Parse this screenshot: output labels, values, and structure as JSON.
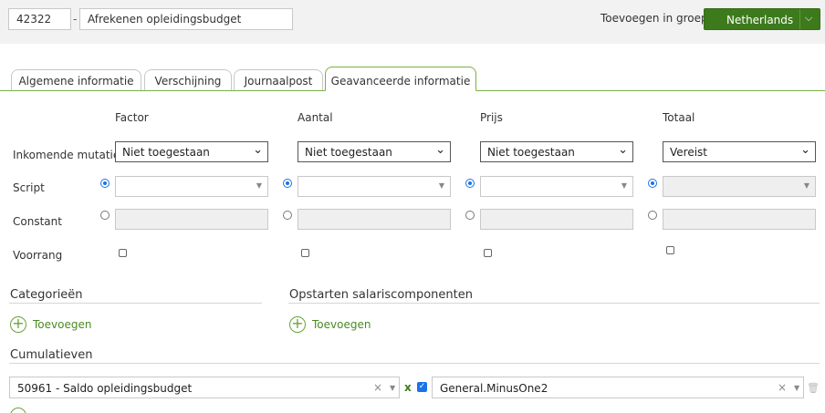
{
  "header": {
    "id_value": "42322",
    "separator": "-",
    "name_value": "Afrekenen opleidingsbudget",
    "group_label": "Toevoegen in groep",
    "group_button": "Netherlands",
    "group_chevron": "⌵"
  },
  "tabs": [
    {
      "label": "Algemene informatie",
      "active": false
    },
    {
      "label": "Verschijning",
      "active": false
    },
    {
      "label": "Journaalpost",
      "active": false
    },
    {
      "label": "Geavanceerde informatie",
      "active": true
    }
  ],
  "columns": [
    "Factor",
    "Aantal",
    "Prijs",
    "Totaal"
  ],
  "rows": {
    "incoming": "Inkomende mutatie",
    "script": "Script",
    "constant": "Constant",
    "priority": "Voorrang"
  },
  "incoming_values": [
    "Niet toegestaan",
    "Niet toegestaan",
    "Niet toegestaan",
    "Vereist"
  ],
  "select_arrow": "⌄",
  "combo_arrow": "▼",
  "sections": {
    "categories": "Categorieën",
    "startup": "Opstarten salariscomponenten",
    "cumulatives": "Cumulatieven",
    "add_label": "Toevoegen",
    "add_symbol": "+"
  },
  "cumulative_row": {
    "left_value": "50961 - Saldo opleidingsbudget",
    "multiplier": "x",
    "check_mark": "✓",
    "right_value": "General.MinusOne2",
    "clear_symbol": "×",
    "trash_icon": "🗑"
  },
  "colors": {
    "accent": "#3d7a1c",
    "tab_active_border": "#7ab042",
    "radio_selected": "#1a73e8"
  }
}
